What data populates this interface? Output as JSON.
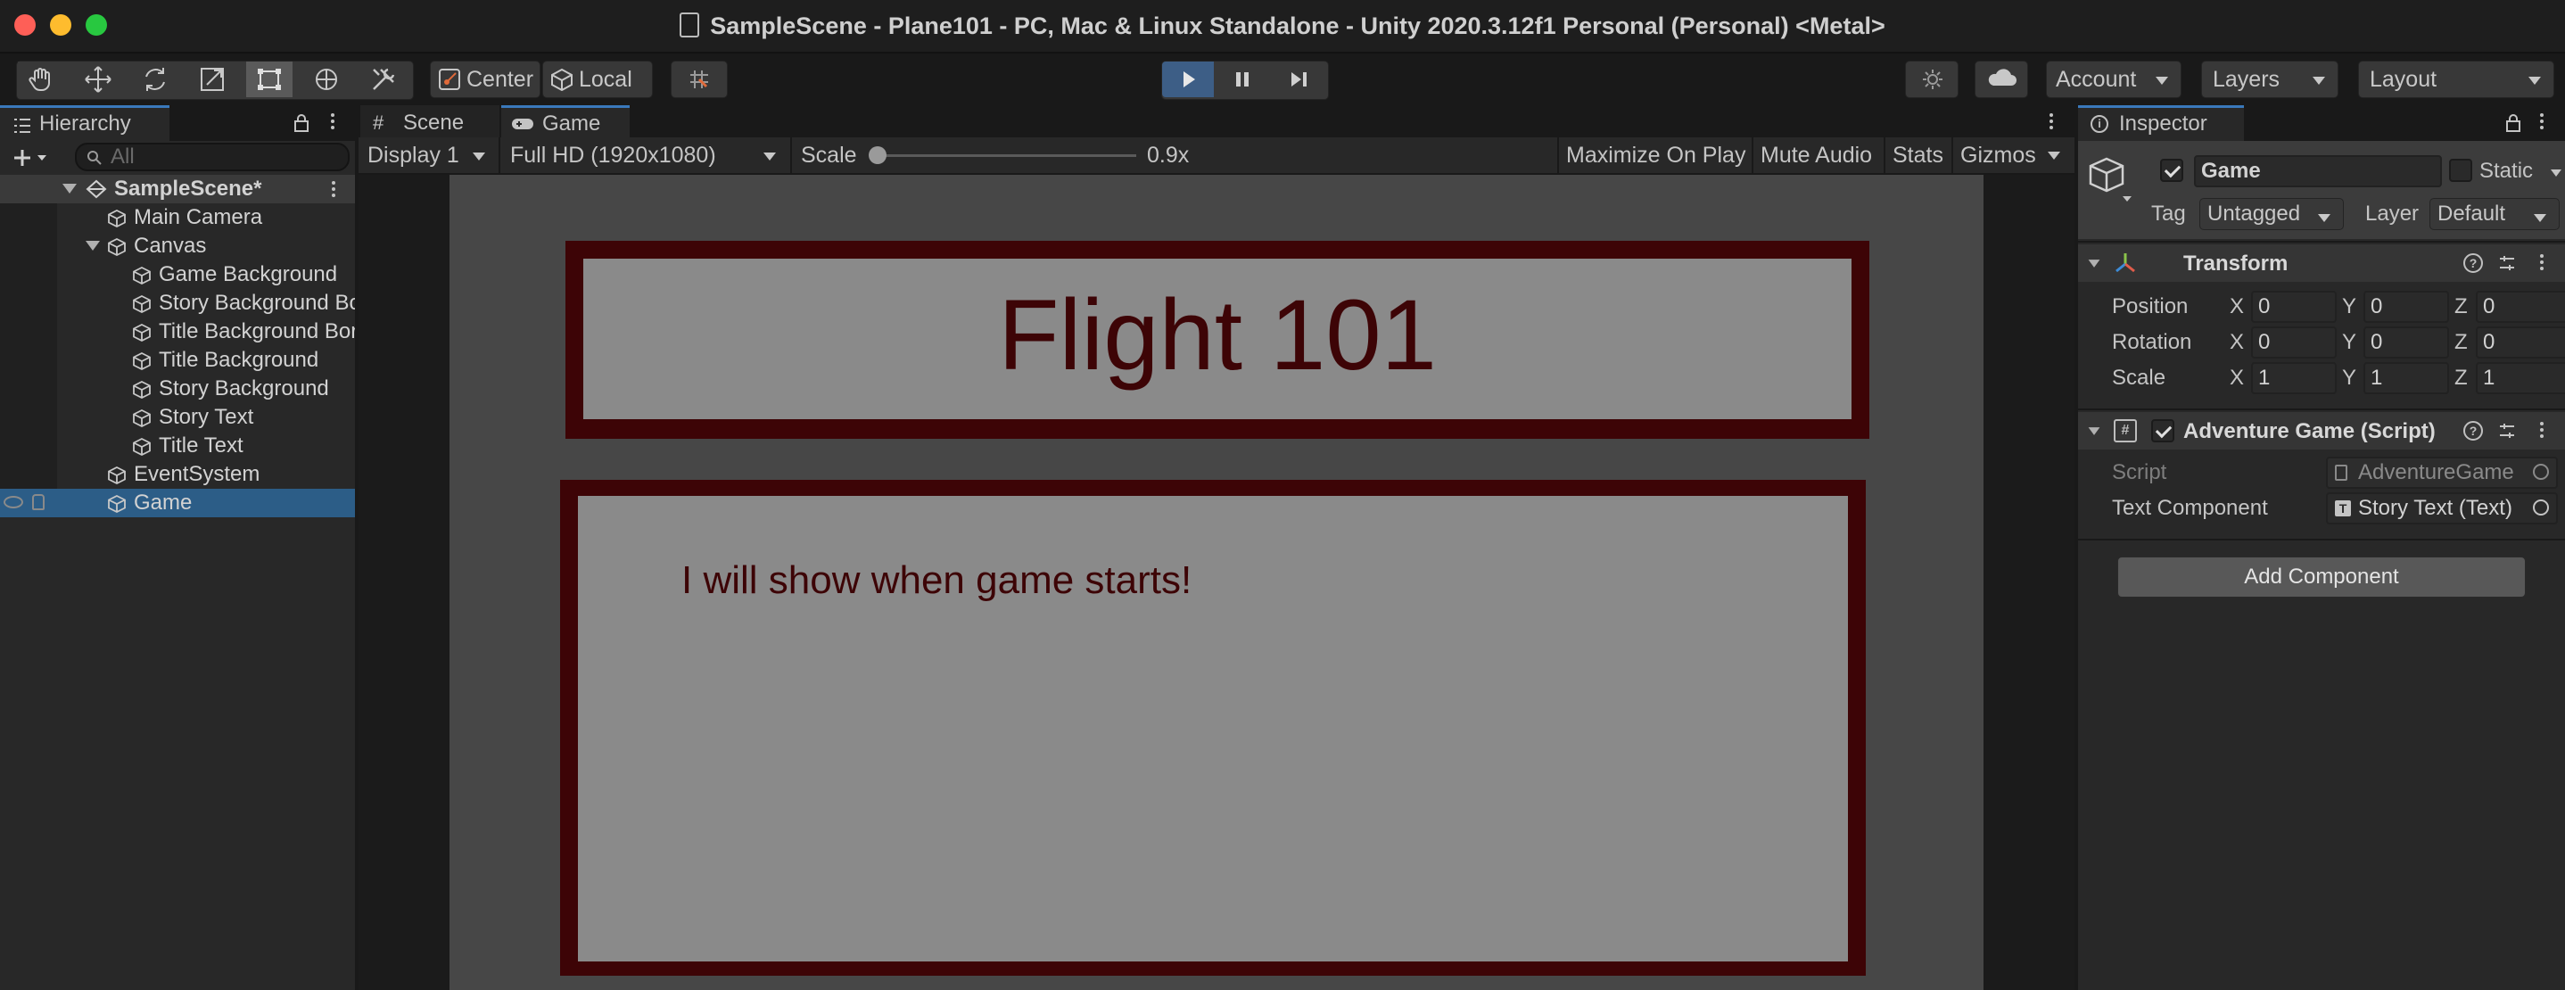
{
  "window": {
    "title": "SampleScene - Plane101 - PC, Mac & Linux Standalone - Unity 2020.3.12f1 Personal (Personal) <Metal>"
  },
  "toolbar": {
    "pivot_label": "Center",
    "space_label": "Local",
    "account_label": "Account",
    "layers_label": "Layers",
    "layout_label": "Layout"
  },
  "hierarchy": {
    "tab_label": "Hierarchy",
    "search_placeholder": "All",
    "scene_name": "SampleScene*",
    "items": [
      {
        "label": "Main Camera",
        "depth": 1
      },
      {
        "label": "Canvas",
        "depth": 1
      },
      {
        "label": "Game Background",
        "depth": 2
      },
      {
        "label": "Story Background Border",
        "depth": 2
      },
      {
        "label": "Title Background Border",
        "depth": 2
      },
      {
        "label": "Title Background",
        "depth": 2
      },
      {
        "label": "Story Background",
        "depth": 2
      },
      {
        "label": "Story Text",
        "depth": 2
      },
      {
        "label": "Title Text",
        "depth": 2
      },
      {
        "label": "EventSystem",
        "depth": 1
      },
      {
        "label": "Game",
        "depth": 1,
        "selected": true
      }
    ]
  },
  "scene_tabs": {
    "scene_label": "Scene",
    "game_label": "Game"
  },
  "game_toolbar": {
    "display": "Display 1",
    "resolution": "Full HD (1920x1080)",
    "scale_label": "Scale",
    "scale_value": "0.9x",
    "scale_fraction": 0.0,
    "maximize_label": "Maximize On Play",
    "mute_label": "Mute Audio",
    "stats_label": "Stats",
    "gizmos_label": "Gizmos"
  },
  "game_view": {
    "title_text": "Flight 101",
    "story_text": "I will show when game starts!",
    "colors": {
      "border": "#3d0406",
      "panel": "#8a8a8a",
      "text": "#3d0406",
      "background": "#474747"
    }
  },
  "inspector": {
    "tab_label": "Inspector",
    "object_name": "Game",
    "static_label": "Static",
    "tag_label": "Tag",
    "tag_value": "Untagged",
    "layer_label": "Layer",
    "layer_value": "Default",
    "transform": {
      "title": "Transform",
      "rows": [
        {
          "label": "Position",
          "x": "0",
          "y": "0",
          "z": "0"
        },
        {
          "label": "Rotation",
          "x": "0",
          "y": "0",
          "z": "0"
        },
        {
          "label": "Scale",
          "x": "1",
          "y": "1",
          "z": "1"
        }
      ],
      "axis_x": "X",
      "axis_y": "Y",
      "axis_z": "Z"
    },
    "script_component": {
      "title": "Adventure Game (Script)",
      "script_label": "Script",
      "script_value": "AdventureGame",
      "text_label": "Text Component",
      "text_value": "Story Text (Text)"
    },
    "add_component_label": "Add Component"
  }
}
